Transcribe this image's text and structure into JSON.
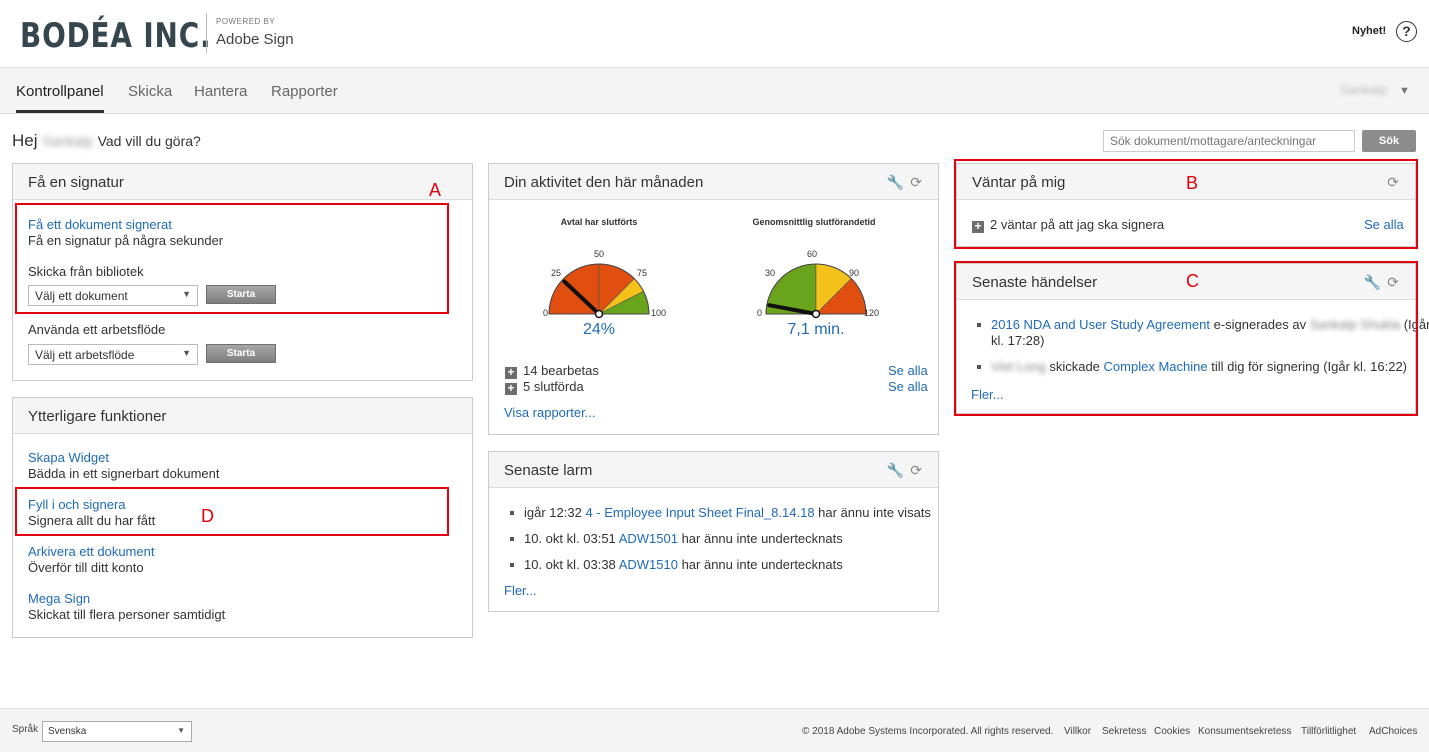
{
  "header": {
    "brand": "BODÉA INC.",
    "powered_by": "POWERED BY",
    "product": "Adobe Sign",
    "news": "Nyhet!",
    "help_icon": "?"
  },
  "nav": {
    "tabs": [
      "Kontrollpanel",
      "Skicka",
      "Hantera",
      "Rapporter"
    ],
    "active": "Kontrollpanel",
    "user": "Sankalp"
  },
  "greeting": {
    "hello": "Hej",
    "name": "Sankalp",
    "question": "Vad vill du göra?"
  },
  "search": {
    "placeholder": "Sök dokument/mottagare/anteckningar",
    "button": "Sök"
  },
  "get_signature": {
    "title": "Få en signatur",
    "link": "Få ett dokument signerat",
    "link_desc": "Få en signatur på några sekunder",
    "library_label": "Skicka från bibliotek",
    "library_select": "Välj ett dokument",
    "library_button": "Starta",
    "workflow_label": "Använda ett arbetsflöde",
    "workflow_select": "Välj ett arbetsflöde",
    "workflow_button": "Starta"
  },
  "more_functions": {
    "title": "Ytterligare funktioner",
    "items": [
      {
        "label": "Skapa Widget",
        "desc": "Bädda in ett signerbart dokument"
      },
      {
        "label": "Fyll i och signera",
        "desc": "Signera allt du har fått"
      },
      {
        "label": "Arkivera ett dokument",
        "desc": "Överför till ditt konto"
      },
      {
        "label": "Mega Sign",
        "desc": "Skickat till flera personer samtidigt"
      }
    ]
  },
  "activity": {
    "title": "Din aktivitet den här månaden",
    "gauge1": {
      "title": "Avtal har slutförts",
      "ticks": [
        "0",
        "25",
        "50",
        "75",
        "100"
      ],
      "value_label": "24%",
      "value": 24,
      "max": 100
    },
    "gauge2": {
      "title": "Genomsnittlig slutförandetid",
      "ticks": [
        "0",
        "30",
        "60",
        "90",
        "120"
      ],
      "value_label": "7,1 min.",
      "value": 7.1,
      "max": 120
    },
    "in_progress": "14 bearbetas",
    "completed": "5 slutförda",
    "see_all_1": "Se alla",
    "see_all_2": "Se alla",
    "reports_link": "Visa rapporter..."
  },
  "alarms": {
    "title": "Senaste larm",
    "items": [
      {
        "time": "igår 12:32",
        "link": "4 - Employee Input Sheet Final_8.14.18",
        "text": "har ännu inte visats"
      },
      {
        "time": "10. okt kl. 03:51",
        "link": "ADW1501",
        "text": "har ännu inte undertecknats"
      },
      {
        "time": "10. okt kl. 03:38",
        "link": "ADW1510",
        "text": "har ännu inte undertecknats"
      }
    ],
    "more": "Fler..."
  },
  "waiting": {
    "title": "Väntar på mig",
    "item": "2 väntar på att jag ska signera",
    "see_all": "Se alla"
  },
  "events": {
    "title": "Senaste händelser",
    "item1_link": "2016 NDA and User Study Agreement",
    "item1_text": "e-signerades av",
    "item1_person": "Sankalp Shukla",
    "item1_time_a": "(Igår",
    "item1_time_b": "kl. 17:28)",
    "item2_person": "Viet Long",
    "item2_text1": "skickade",
    "item2_link": "Complex Machine",
    "item2_text2": "till dig för signering (Igår kl. 16:22)",
    "more": "Fler..."
  },
  "annotations": {
    "a": "A",
    "b": "B",
    "c": "C",
    "d": "D",
    "color": "#e3000f"
  },
  "footer": {
    "language_label": "Språk",
    "language_value": "Svenska",
    "copyright": "© 2018 Adobe Systems Incorporated. All rights reserved.",
    "links": [
      "Villkor",
      "Sekretess",
      "Cookies",
      "Konsumentsekretess",
      "Tillförlitlighet",
      "AdChoices"
    ]
  },
  "colors": {
    "link": "#1f6bb8",
    "gauge_red": "#e04f10",
    "gauge_yellow": "#f5c21b",
    "gauge_green": "#6aa31c"
  }
}
